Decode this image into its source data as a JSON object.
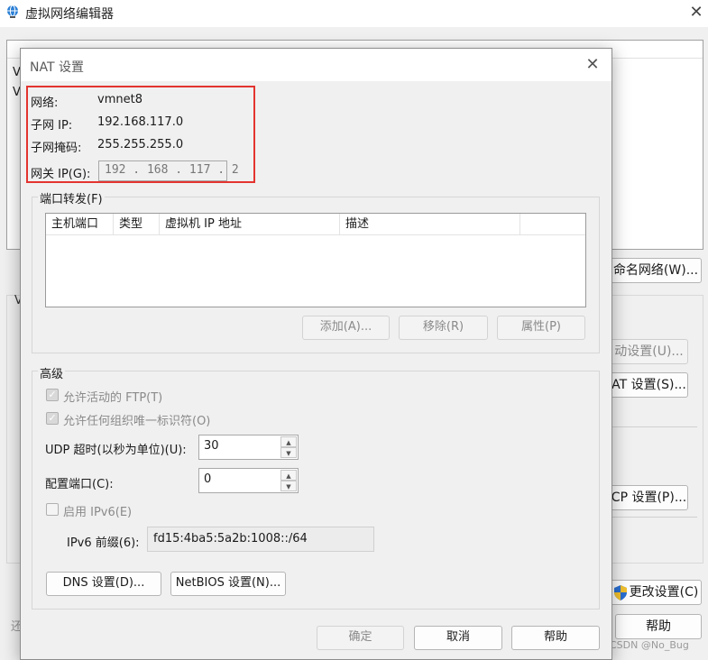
{
  "bg_window": {
    "title": "虚拟网络编辑器",
    "list_rows": [
      "V",
      "V"
    ],
    "left_letter_group": "V",
    "left_letter_bottom": "还",
    "buttons": {
      "rename": "命名网络(W)...",
      "auto_settings": "动设置(U)...",
      "nat_settings": "AT 设置(S)...",
      "dhcp_settings": "CP 设置(P)...",
      "change_settings": "更改设置(C)",
      "help": "帮助"
    },
    "watermark": "CSDN @No_Bug"
  },
  "dialog": {
    "title": "NAT 设置",
    "network_label": "网络:",
    "network_value": "vmnet8",
    "subnet_ip_label": "子网 IP:",
    "subnet_ip_value": "192.168.117.0",
    "subnet_mask_label": "子网掩码:",
    "subnet_mask_value": "255.255.255.0",
    "gateway_label": "网关 IP(G):",
    "gateway_value": "192 . 168 . 117 .  2",
    "port_forwarding": {
      "group_label": "端口转发(F)",
      "columns": [
        "主机端口",
        "类型",
        "虚拟机 IP 地址",
        "描述"
      ],
      "add": "添加(A)...",
      "remove": "移除(R)",
      "properties": "属性(P)"
    },
    "advanced": {
      "group_label": "高级",
      "allow_ftp": "允许活动的 FTP(T)",
      "allow_uid": "允许任何组织唯一标识符(O)",
      "udp_timeout_label": "UDP 超时(以秒为单位)(U):",
      "udp_timeout_value": "30",
      "config_port_label": "配置端口(C):",
      "config_port_value": "0",
      "enable_ipv6": "启用 IPv6(E)",
      "ipv6_prefix_label": "IPv6 前缀(6):",
      "ipv6_prefix_value": "fd15:4ba5:5a2b:1008::/64",
      "dns_button": "DNS 设置(D)...",
      "netbios_button": "NetBIOS 设置(N)..."
    },
    "ok": "确定",
    "cancel": "取消",
    "help": "帮助"
  }
}
